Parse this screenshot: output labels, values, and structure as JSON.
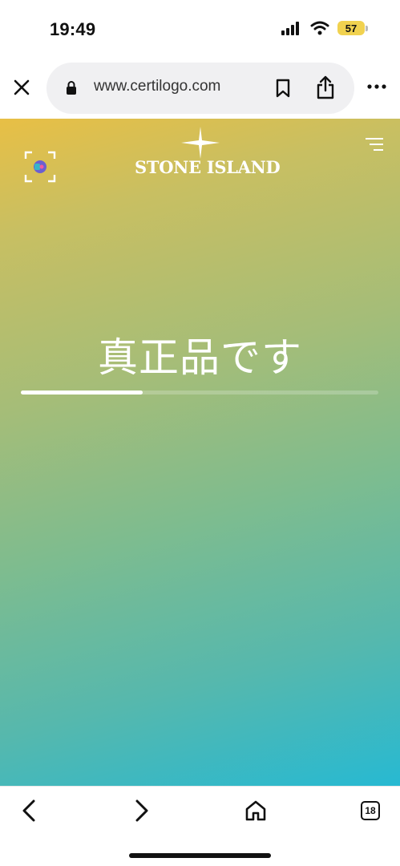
{
  "status_bar": {
    "time": "19:49",
    "battery_level": "57",
    "icons": [
      "signal-icon",
      "wifi-icon",
      "battery-icon"
    ]
  },
  "browser": {
    "url": "www.certilogo.com",
    "icons": {
      "close": "close-icon",
      "lock": "lock-icon",
      "bookmark": "bookmark-icon",
      "share": "share-icon",
      "more": "more-icon"
    }
  },
  "page": {
    "brand": "STONE ISLAND",
    "message": "真正品です",
    "progress": 0.34,
    "icons": {
      "scan": "scan-icon",
      "logo": "compass-rose-icon",
      "menu": "menu-icon"
    },
    "colors": {
      "gradient_top": "#e8bf45",
      "gradient_bottom": "#27b9d2",
      "text": "#ffffff"
    }
  },
  "toolbar": {
    "tab_count": "18",
    "icons": [
      "back-icon",
      "forward-icon",
      "home-icon",
      "tabs-icon"
    ]
  }
}
